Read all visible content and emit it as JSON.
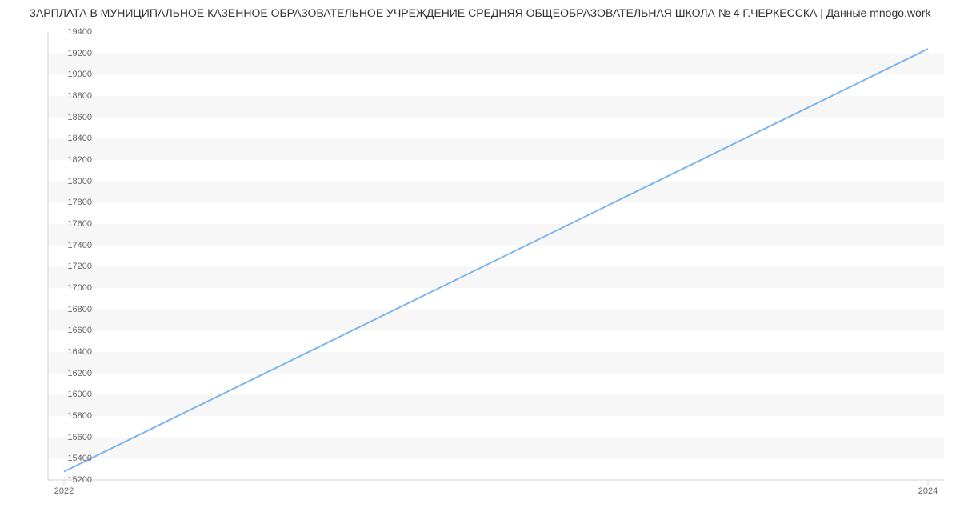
{
  "chart_data": {
    "type": "line",
    "title": "ЗАРПЛАТА В МУНИЦИПАЛЬНОЕ КАЗЕННОЕ ОБРАЗОВАТЕЛЬНОЕ УЧРЕЖДЕНИЕ СРЕДНЯЯ ОБЩЕОБРАЗОВАТЕЛЬНАЯ ШКОЛА № 4 Г.ЧЕРКЕССКА | Данные mnogo.work",
    "xlabel": "",
    "ylabel": "",
    "x": [
      2022,
      2024
    ],
    "values": [
      15279,
      19242
    ],
    "xlim": [
      2022,
      2024
    ],
    "ylim": [
      15200,
      19400
    ],
    "y_ticks": [
      15200,
      15400,
      15600,
      15800,
      16000,
      16200,
      16400,
      16600,
      16800,
      17000,
      17200,
      17400,
      17600,
      17800,
      18000,
      18200,
      18400,
      18600,
      18800,
      19000,
      19200,
      19400
    ],
    "x_ticks": [
      2022,
      2024
    ],
    "grid_bands_alternating": true,
    "line_color": "#7cb5ec",
    "band_color": "#f7f7f7"
  }
}
